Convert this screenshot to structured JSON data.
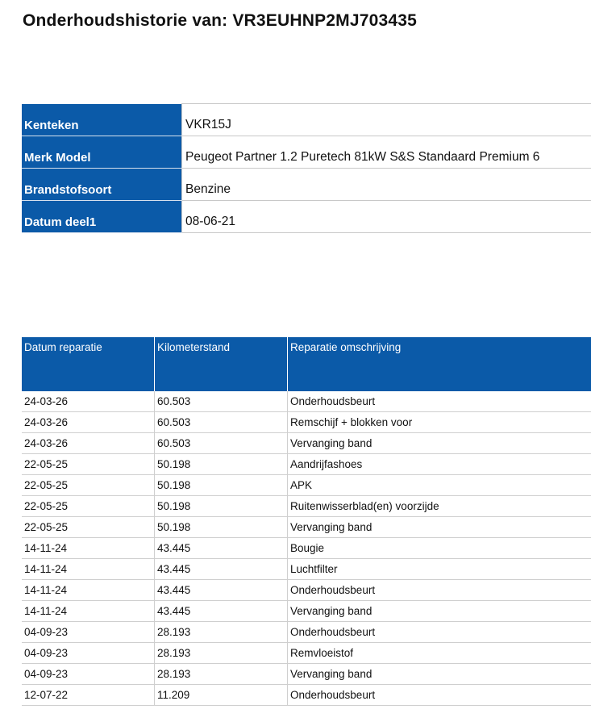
{
  "title": "Onderhoudshistorie van: VR3EUHNP2MJ703435",
  "vehicle": [
    {
      "label": "Kenteken",
      "value": "VKR15J"
    },
    {
      "label": "Merk Model",
      "value": "Peugeot Partner 1.2 Puretech 81kW S&S Standaard Premium 6"
    },
    {
      "label": "Brandstofsoort",
      "value": "Benzine"
    },
    {
      "label": "Datum deel1",
      "value": "08-06-21"
    }
  ],
  "repairs": {
    "headers": [
      "Datum reparatie",
      "Kilometerstand",
      "Reparatie omschrijving"
    ],
    "rows": [
      [
        "24-03-26",
        "60.503",
        "Onderhoudsbeurt"
      ],
      [
        "24-03-26",
        "60.503",
        "Remschijf + blokken voor"
      ],
      [
        "24-03-26",
        "60.503",
        "Vervanging band"
      ],
      [
        "22-05-25",
        "50.198",
        "Aandrijfashoes"
      ],
      [
        "22-05-25",
        "50.198",
        "APK"
      ],
      [
        "22-05-25",
        "50.198",
        "Ruitenwisserblad(en) voorzijde"
      ],
      [
        "22-05-25",
        "50.198",
        "Vervanging band"
      ],
      [
        "14-11-24",
        "43.445",
        "Bougie"
      ],
      [
        "14-11-24",
        "43.445",
        "Luchtfilter"
      ],
      [
        "14-11-24",
        "43.445",
        "Onderhoudsbeurt"
      ],
      [
        "14-11-24",
        "43.445",
        "Vervanging band"
      ],
      [
        "04-09-23",
        "28.193",
        "Onderhoudsbeurt"
      ],
      [
        "04-09-23",
        "28.193",
        "Remvloeistof"
      ],
      [
        "04-09-23",
        "28.193",
        "Vervanging band"
      ],
      [
        "12-07-22",
        "11.209",
        "Onderhoudsbeurt"
      ]
    ]
  }
}
